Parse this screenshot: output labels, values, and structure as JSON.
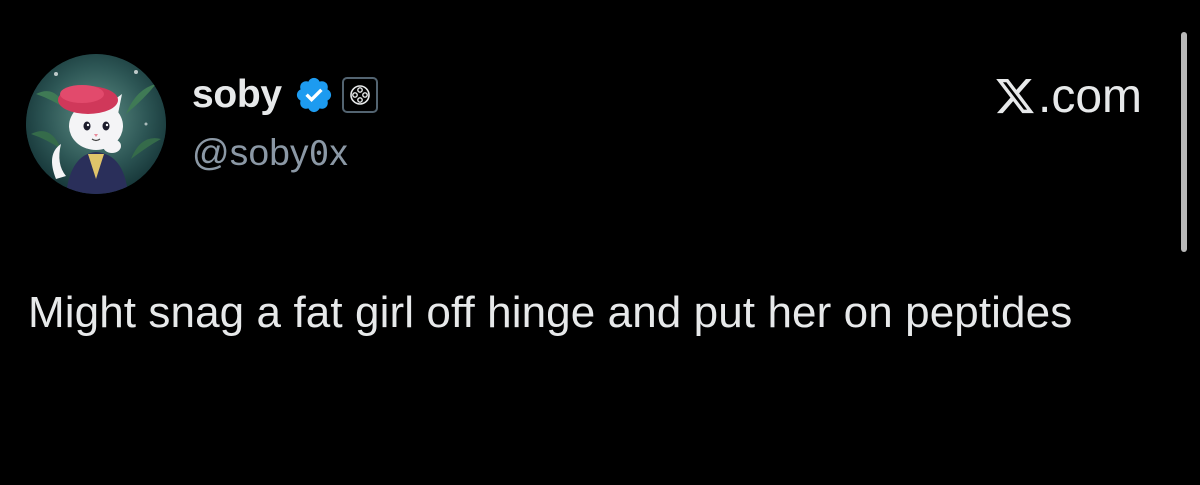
{
  "author": {
    "display_name": "soby",
    "handle_prefix": "@soby",
    "handle_zero": "0",
    "handle_suffix": "x",
    "verified": true,
    "verified_color": "#1d9bf0",
    "avatar": "cartoon-cat-avatar"
  },
  "brand": {
    "label": ".com",
    "icon": "x-logo-icon"
  },
  "tweet": {
    "text": "Might snag a fat girl off hinge and put her on peptides"
  },
  "colors": {
    "background": "#000000",
    "text": "#e7e9ea",
    "secondary_text": "#8b98a5"
  }
}
